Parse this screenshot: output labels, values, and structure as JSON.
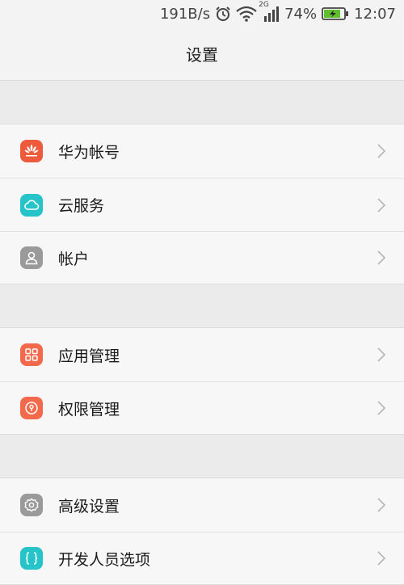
{
  "status_bar": {
    "net_speed": "191B/s",
    "network_type": "2G",
    "battery": "74%",
    "time": "12:07",
    "icons": [
      "alarm-icon",
      "wifi-icon",
      "signal-icon",
      "battery-charging-icon"
    ]
  },
  "header": {
    "title": "设置"
  },
  "groups": [
    {
      "items": [
        {
          "label": "华为帐号",
          "icon": "huawei-logo-icon",
          "icon_color": "#ee5a3c"
        },
        {
          "label": "云服务",
          "icon": "cloud-icon",
          "icon_color": "#26c4c8"
        },
        {
          "label": "帐户",
          "icon": "user-icon",
          "icon_color": "#9a9a9a"
        }
      ]
    },
    {
      "items": [
        {
          "label": "应用管理",
          "icon": "apps-grid-icon",
          "icon_color": "#f26a4b"
        },
        {
          "label": "权限管理",
          "icon": "lock-icon",
          "icon_color": "#f26a4b"
        }
      ]
    },
    {
      "items": [
        {
          "label": "高级设置",
          "icon": "gear-icon",
          "icon_color": "#9a9a9a"
        },
        {
          "label": "开发人员选项",
          "icon": "braces-icon",
          "icon_color": "#26c4c8"
        }
      ]
    }
  ],
  "colors": {
    "background": "#f3f3f3",
    "section_gap": "#ebebeb",
    "row_background": "#f7f7f7",
    "chevron": "#b5b5b5"
  }
}
